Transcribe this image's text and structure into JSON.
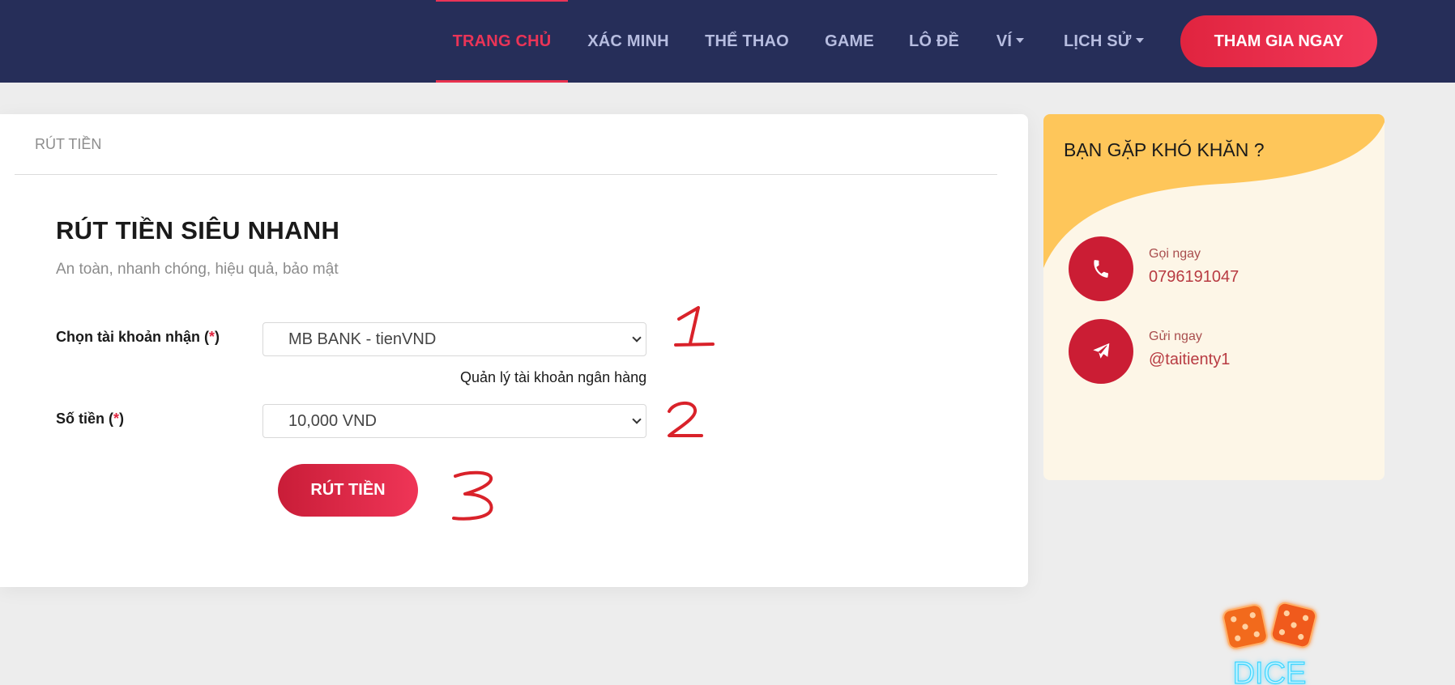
{
  "nav": {
    "items": [
      {
        "label": "TRANG CHỦ",
        "active": true
      },
      {
        "label": "XÁC MINH"
      },
      {
        "label": "THỂ THAO"
      },
      {
        "label": "GAME"
      },
      {
        "label": "LÔ ĐỀ"
      },
      {
        "label": "VÍ",
        "dropdown": true
      },
      {
        "label": "LỊCH SỬ",
        "dropdown": true
      }
    ],
    "join_label": "THAM GIA NGAY"
  },
  "main": {
    "header": "RÚT TIỀN",
    "title": "RÚT TIỀN SIÊU NHANH",
    "subtitle": "An toàn, nhanh chóng, hiệu quả, bảo mật",
    "account_label": "Chọn tài khoản nhận",
    "required_mark": "*",
    "account_value": "MB BANK - tienVND",
    "manage_link": "Quản lý tài khoản ngân hàng",
    "amount_label": "Số tiền",
    "amount_value": "10,000 VND",
    "submit_label": "RÚT TIỀN"
  },
  "support": {
    "title": "BẠN GẶP KHÓ KHĂN ?",
    "call_label": "Gọi ngay",
    "call_value": "0796191047",
    "send_label": "Gửi ngay",
    "send_value": "@taitienty1"
  },
  "annotations": [
    "1",
    "2",
    "3"
  ],
  "logo_text": "DICE",
  "icons": [
    "phone-icon",
    "telegram-icon",
    "chevron-down-icon",
    "dice-logo"
  ],
  "colors": {
    "navbar": "#262e59",
    "accent": "#ea3457",
    "support_bg": "#fdf6e7",
    "support_wave": "#fec65a",
    "annotation": "#d9222a"
  }
}
